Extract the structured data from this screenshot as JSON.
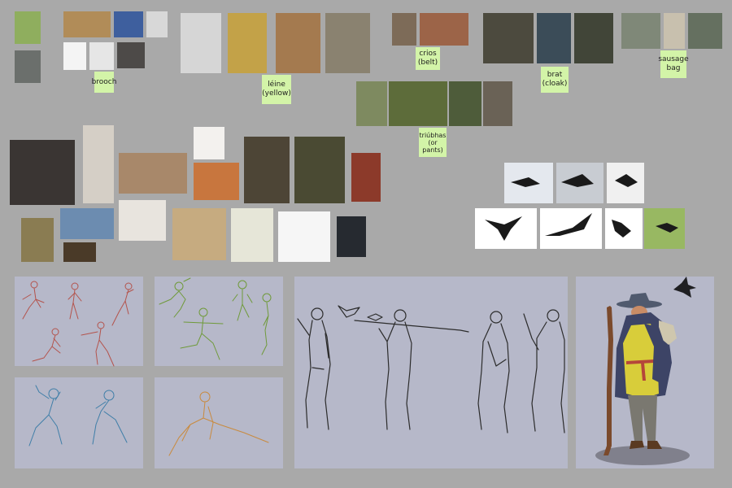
{
  "board": {
    "background": "#a9a9a9",
    "panel_color": "#b6b8c9",
    "note_color": "#d3f4a8"
  },
  "labels": {
    "brooch": "brooch",
    "leine": "léine\n(yellow)",
    "crios": "crios\n(belt)",
    "brat": "brat\n(cloak)",
    "sausage_bag": "sausage\nbag",
    "triubhas": "triúbhas\n(or\npants)"
  },
  "sketch_colors": {
    "red": "#b4534c",
    "green": "#6f9a3a",
    "blue": "#3f7ea8",
    "orange": "#c98a3e",
    "ink": "#2c2c2c"
  },
  "character": {
    "hat": "#505a6e",
    "cloak": "#3d4466",
    "tunic": "#d8cd3a",
    "trousers": "#7a7870",
    "skin": "#c98c66",
    "belt": "#b5463a",
    "staff": "#7b4a2c",
    "shadow": "#80808c"
  }
}
